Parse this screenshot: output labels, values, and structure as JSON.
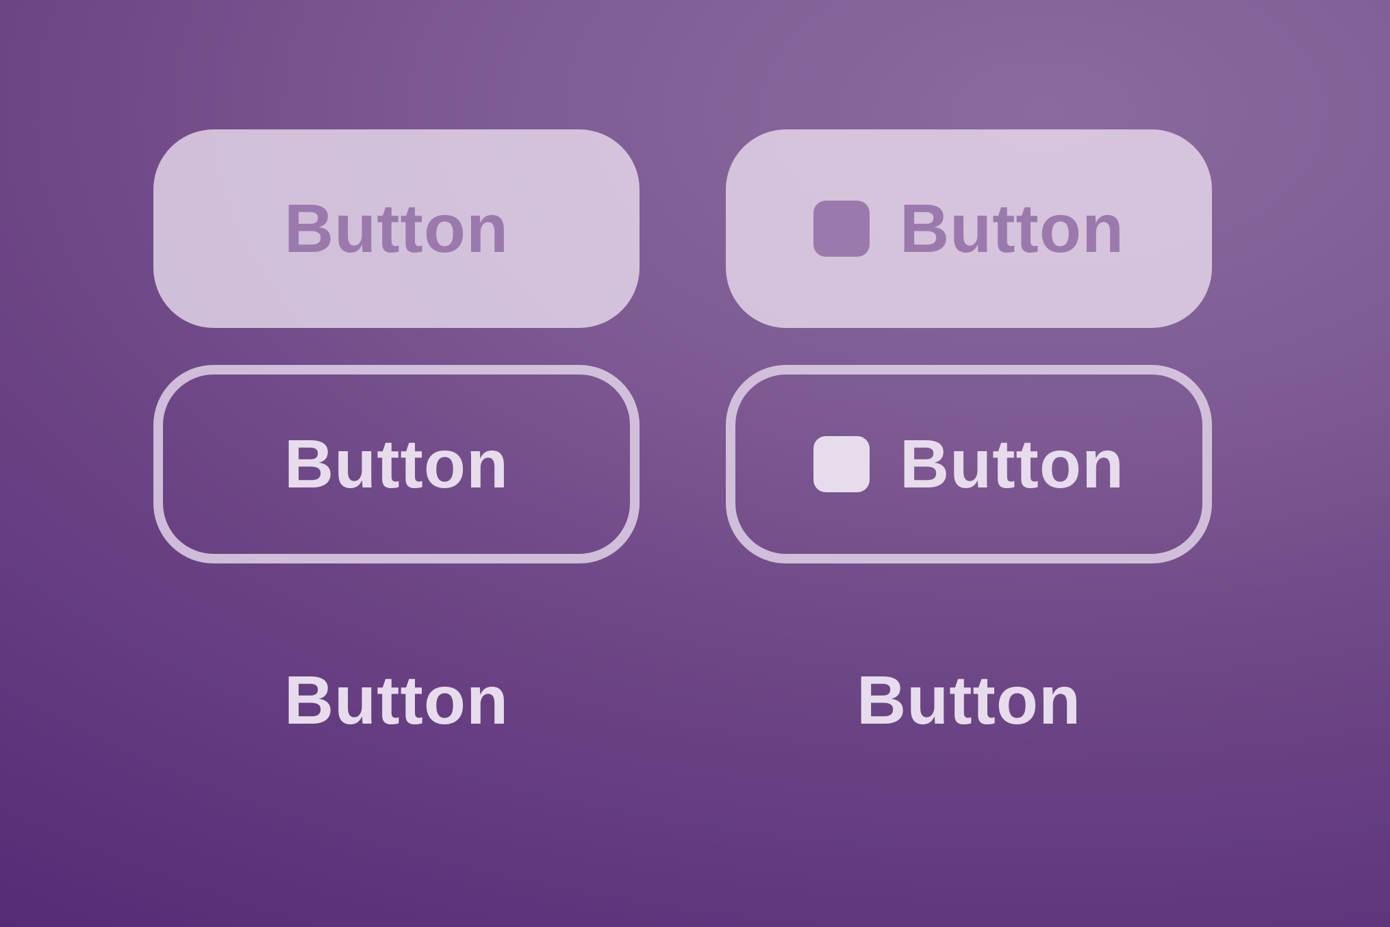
{
  "colors": {
    "background_light": "#8b6a9e",
    "background_dark": "#552a76",
    "filled_surface": "#ded0e5",
    "filled_label": "#9b79ad",
    "outline": "#e1d2e8",
    "light_label": "#e7dcec"
  },
  "buttons": {
    "filled": {
      "label": "Button"
    },
    "filled_icon": {
      "label": "Button",
      "icon": "square-icon"
    },
    "outlined": {
      "label": "Button"
    },
    "outlined_icon": {
      "label": "Button",
      "icon": "square-icon"
    },
    "text": {
      "label": "Button"
    },
    "text_right": {
      "label": "Button"
    }
  }
}
